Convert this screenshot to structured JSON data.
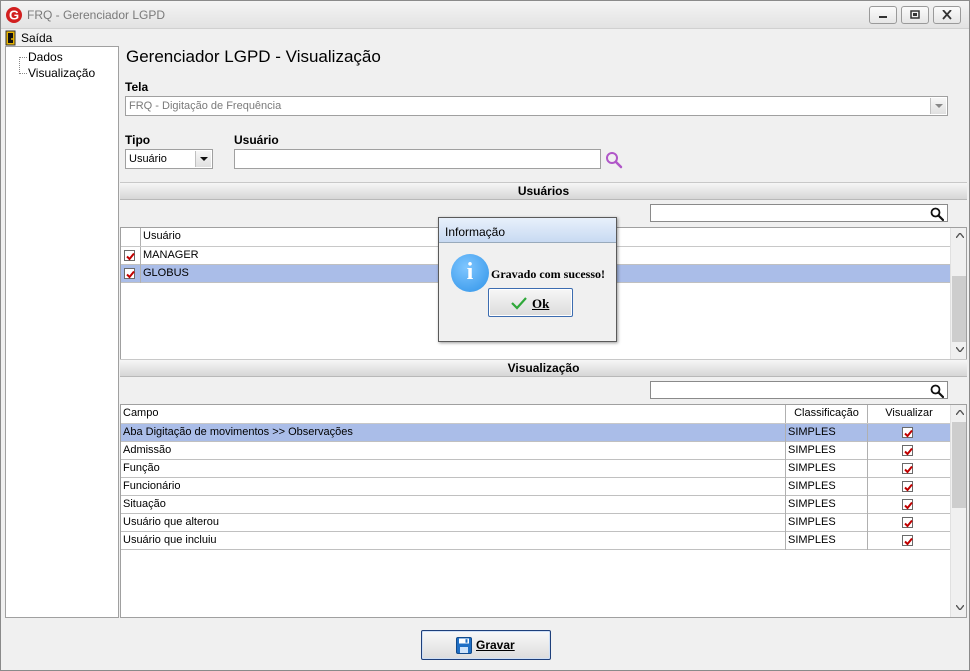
{
  "window": {
    "title": "FRQ - Gerenciador LGPD"
  },
  "menu": {
    "exit_label": "Saída"
  },
  "tree": {
    "items": [
      {
        "label": "Dados"
      },
      {
        "label": "Visualização"
      }
    ]
  },
  "page": {
    "title": "Gerenciador LGPD - Visualização",
    "tela_label": "Tela",
    "tela_value": "FRQ - Digitação de Frequência",
    "tipo_label": "Tipo",
    "tipo_value": "Usuário",
    "usuario_label": "Usuário",
    "usuario_value": ""
  },
  "usuarios": {
    "header": "Usuários",
    "search_value": "",
    "column": "Usuário",
    "rows": [
      {
        "checked": true,
        "name": "MANAGER",
        "selected": false
      },
      {
        "checked": true,
        "name": "GLOBUS",
        "selected": true
      }
    ]
  },
  "visualizacao": {
    "header": "Visualização",
    "search_value": "",
    "columns": {
      "campo": "Campo",
      "classificacao": "Classificação",
      "visualizar": "Visualizar"
    },
    "rows": [
      {
        "campo": "Aba Digitação de movimentos >> Observações",
        "classificacao": "SIMPLES",
        "visualizar": true,
        "selected": true
      },
      {
        "campo": "Admissão",
        "classificacao": "SIMPLES",
        "visualizar": true,
        "selected": false
      },
      {
        "campo": "Função",
        "classificacao": "SIMPLES",
        "visualizar": true,
        "selected": false
      },
      {
        "campo": "Funcionário",
        "classificacao": "SIMPLES",
        "visualizar": true,
        "selected": false
      },
      {
        "campo": "Situação",
        "classificacao": "SIMPLES",
        "visualizar": true,
        "selected": false
      },
      {
        "campo": "Usuário que alterou",
        "classificacao": "SIMPLES",
        "visualizar": true,
        "selected": false
      },
      {
        "campo": "Usuário que incluiu",
        "classificacao": "SIMPLES",
        "visualizar": true,
        "selected": false
      }
    ]
  },
  "dialog": {
    "title": "Informação",
    "message": "Gravado com sucesso!",
    "ok_label": "Ok"
  },
  "footer": {
    "save_label": "Gravar"
  },
  "colors": {
    "selection": "#aabde8",
    "check": "#c00000",
    "accent": "#2f93e8"
  }
}
